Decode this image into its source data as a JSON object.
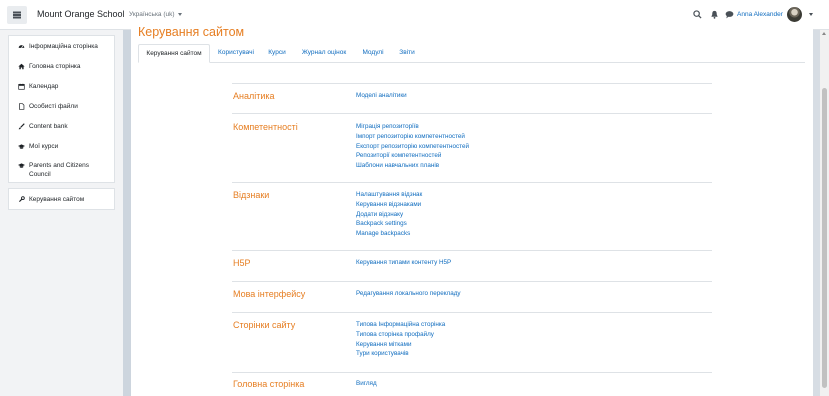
{
  "navbar": {
    "site_name": "Mount Orange School",
    "language": "Українська (uk)",
    "user_name": "Anna Alexander"
  },
  "sidebar": {
    "items": [
      {
        "label": "Інформаційна сторінка",
        "icon": "dashboard-icon"
      },
      {
        "label": "Головна сторінка",
        "icon": "home-icon"
      },
      {
        "label": "Календар",
        "icon": "calendar-icon"
      },
      {
        "label": "Особисті файли",
        "icon": "file-icon"
      },
      {
        "label": "Content bank",
        "icon": "paint-brush-icon"
      },
      {
        "label": "Мої курси",
        "icon": "graduation-cap-icon"
      },
      {
        "label": "Parents and Citizens Council",
        "icon": "graduation-cap-icon"
      }
    ],
    "admin_item": {
      "label": "Керування сайтом",
      "icon": "wrench-icon"
    }
  },
  "main": {
    "title": "Керування сайтом",
    "tabs": [
      "Керування сайтом",
      "Користувачі",
      "Курси",
      "Журнал оцінок",
      "Модулі",
      "Звіти"
    ],
    "sections": [
      {
        "title": "Аналітика",
        "links": [
          "Моделі аналітики"
        ]
      },
      {
        "title": "Компетентності",
        "links": [
          "Міграція репозиторіїв",
          "Імпорт репозиторію компетентностей",
          "Експорт репозиторію компетентностей",
          "Репозиторії компетентностей",
          "Шаблони навчальних планів"
        ]
      },
      {
        "title": "Відзнаки",
        "links": [
          "Налаштування відзнак",
          "Керування відзнаками",
          "Додати відзнаку",
          "Backpack settings",
          "Manage backpacks"
        ]
      },
      {
        "title": "H5P",
        "links": [
          "Керування типами контенту H5P"
        ]
      },
      {
        "title": "Мова інтерфейсу",
        "links": [
          "Редагування локального перекладу"
        ]
      },
      {
        "title": "Сторінки сайту",
        "links": [
          "Типова Інформаційна сторінка",
          "Типова сторінка профайлу",
          "Керування мітками",
          "Тури користувачів"
        ]
      },
      {
        "title": "Головна сторінка",
        "links": [
          "Вигляд"
        ]
      }
    ]
  },
  "colors": {
    "accent_orange": "#e67e22",
    "link_blue": "#0f6cbf"
  }
}
